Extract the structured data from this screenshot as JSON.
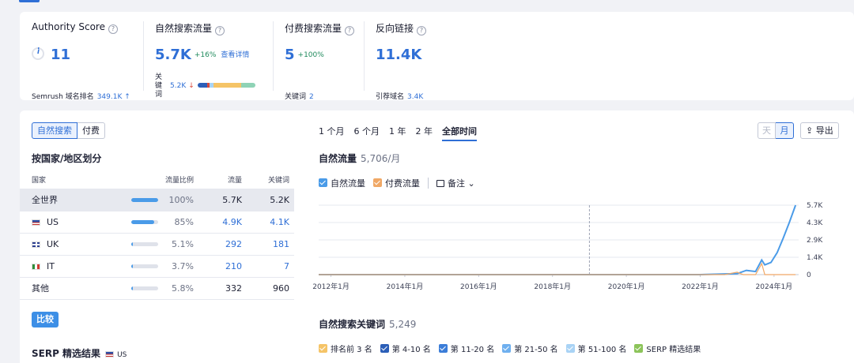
{
  "summary": {
    "authority": {
      "title": "Authority Score",
      "value": "11",
      "sub_label": "Semrush 域名排名",
      "sub_value": "349.1K ↑"
    },
    "organic": {
      "title": "自然搜索流量",
      "value": "5.7K",
      "delta": "+16%",
      "link": "查看详情",
      "kw_label": "关键词",
      "kw_value": "5.2K",
      "kw_arrow": "↓"
    },
    "paid": {
      "title": "付费搜索流量",
      "value": "5",
      "delta": "+100%",
      "sub_label": "关键词",
      "sub_value": "2"
    },
    "backlinks": {
      "title": "反向链接",
      "value": "11.4K",
      "sub_label": "引荐域名",
      "sub_value": "3.4K"
    }
  },
  "left": {
    "toggle": [
      "自然搜索",
      "付费"
    ],
    "section_title": "按国家/地区划分",
    "columns": [
      "国家",
      "流量比例",
      "流量",
      "关键词"
    ],
    "rows": [
      {
        "country": "全世界",
        "flag": "",
        "share_pct": 100,
        "share": "100%",
        "traffic": "5.7K",
        "keywords": "5.2K"
      },
      {
        "country": "US",
        "flag": "us",
        "share_pct": 85,
        "share": "85%",
        "traffic": "4.9K",
        "keywords": "4.1K"
      },
      {
        "country": "UK",
        "flag": "uk",
        "share_pct": 5.1,
        "share": "5.1%",
        "traffic": "292",
        "keywords": "181"
      },
      {
        "country": "IT",
        "flag": "it",
        "share_pct": 3.7,
        "share": "3.7%",
        "traffic": "210",
        "keywords": "7"
      },
      {
        "country": "其他",
        "flag": "",
        "share_pct": 5.8,
        "share": "5.8%",
        "traffic": "332",
        "keywords": "960"
      }
    ],
    "compare_button": "比较",
    "serp_title": "SERP 精选结果",
    "serp_country": "US"
  },
  "chart_controls": {
    "ranges": [
      "1 个月",
      "6 个月",
      "1 年",
      "2 年",
      "全部时间"
    ],
    "active_range": "全部时间",
    "day": "天",
    "month": "月",
    "export": "导出"
  },
  "chart_data": {
    "type": "line",
    "title": "自然流量",
    "title_value": "5,706/月",
    "legend": [
      "自然流量",
      "付费流量"
    ],
    "notes_label": "备注",
    "x_ticks": [
      "2012年1月",
      "2014年1月",
      "2016年1月",
      "2018年1月",
      "2020年1月",
      "2022年1月",
      "2024年1月"
    ],
    "y_ticks": [
      "0",
      "1.4K",
      "2.9K",
      "4.3K",
      "5.7K"
    ],
    "ylim": [
      0,
      5706
    ],
    "xlim": [
      "2011-09",
      "2024-09"
    ],
    "series": [
      {
        "name": "自然流量",
        "color": "#4a9be8",
        "points": [
          [
            "2011-09",
            0
          ],
          [
            "2022-01",
            0
          ],
          [
            "2023-01",
            80
          ],
          [
            "2023-04",
            350
          ],
          [
            "2023-07",
            250
          ],
          [
            "2023-09",
            1200
          ],
          [
            "2023-10",
            800
          ],
          [
            "2023-12",
            1000
          ],
          [
            "2024-02",
            1800
          ],
          [
            "2024-04",
            3000
          ],
          [
            "2024-06",
            4300
          ],
          [
            "2024-08",
            5706
          ]
        ]
      },
      {
        "name": "付费流量",
        "color": "#f0a866",
        "points": [
          [
            "2011-09",
            0
          ],
          [
            "2022-09",
            0
          ],
          [
            "2023-01",
            200
          ],
          [
            "2023-03",
            0
          ],
          [
            "2023-07",
            0
          ],
          [
            "2023-09",
            900
          ],
          [
            "2023-10",
            0
          ],
          [
            "2024-08",
            0
          ]
        ]
      }
    ],
    "marker_date": "2019-01"
  },
  "keywords_section": {
    "title": "自然搜索关键词",
    "count": "5,249",
    "legend": [
      {
        "label": "排名前 3 名",
        "color": "#f5c467"
      },
      {
        "label": "第 4-10 名",
        "color": "#2c5fb8"
      },
      {
        "label": "第 11-20 名",
        "color": "#3b7dd8"
      },
      {
        "label": "第 21-50 名",
        "color": "#6fb0ef"
      },
      {
        "label": "第 51-100 名",
        "color": "#a9d3f5"
      },
      {
        "label": "SERP 精选结果",
        "color": "#8cc45a"
      }
    ]
  }
}
